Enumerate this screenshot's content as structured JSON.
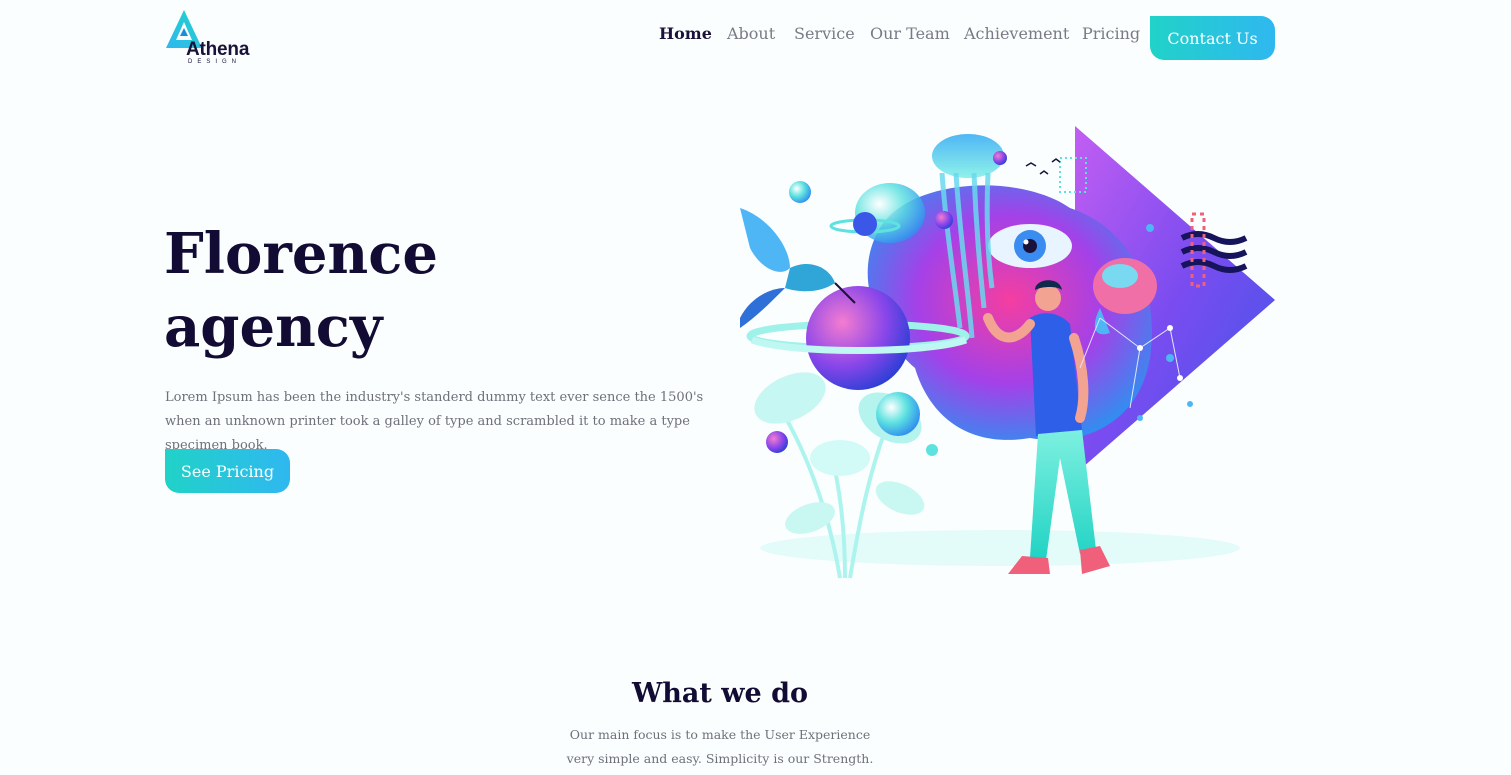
{
  "brand": {
    "name": "Athena",
    "tagline": "DESIGN"
  },
  "nav": {
    "items": [
      {
        "label": "Home",
        "active": true
      },
      {
        "label": "About",
        "active": false
      },
      {
        "label": "Service",
        "active": false
      },
      {
        "label": "Our Team",
        "active": false
      },
      {
        "label": "Achievement",
        "active": false
      },
      {
        "label": "Pricing",
        "active": false
      }
    ],
    "contact_label": "Contact Us"
  },
  "hero": {
    "title_line1": "Florence",
    "title_line2": "agency",
    "description": "Lorem Ipsum has been the industry's standerd dummy text ever sence the 1500's when an unknown printer took a galley of type and scrambled it to make a type specimen book.",
    "cta_label": "See Pricing"
  },
  "what_we_do": {
    "title": "What we do",
    "description": "Our main focus is to make the User Experience very simple and easy. Simplicity is our Strength."
  },
  "colors": {
    "accent_start": "#21d2c8",
    "accent_end": "#2fb8f0",
    "heading": "#120b33",
    "body_text": "#6f6f7a"
  }
}
